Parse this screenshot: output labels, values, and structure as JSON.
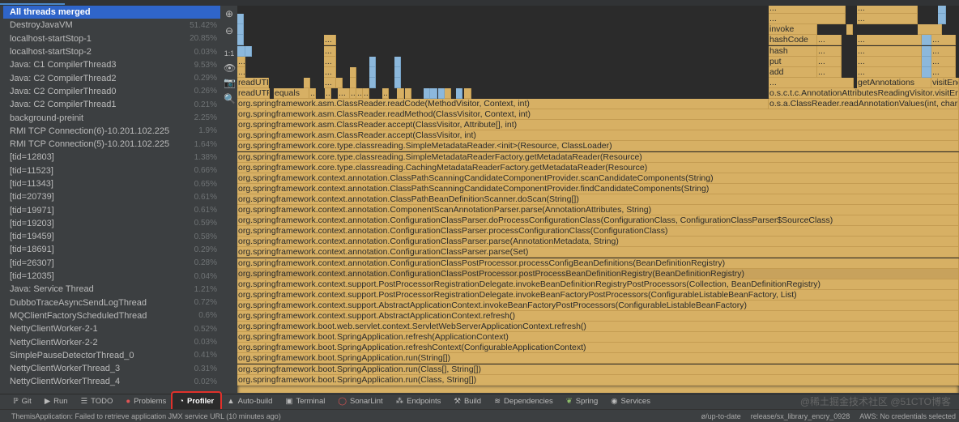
{
  "threads": [
    {
      "name": "All threads merged",
      "pct": ""
    },
    {
      "name": "DestroyJavaVM",
      "pct": "51.42%"
    },
    {
      "name": "localhost-startStop-1",
      "pct": "20.85%"
    },
    {
      "name": "localhost-startStop-2",
      "pct": "0.03%"
    },
    {
      "name": "Java: C1 CompilerThread3",
      "pct": "9.53%"
    },
    {
      "name": "Java: C2 CompilerThread2",
      "pct": "0.29%"
    },
    {
      "name": "Java: C2 CompilerThread0",
      "pct": "0.26%"
    },
    {
      "name": "Java: C2 CompilerThread1",
      "pct": "0.21%"
    },
    {
      "name": "background-preinit",
      "pct": "2.25%"
    },
    {
      "name": "RMI TCP Connection(6)-10.201.102.225",
      "pct": "1.9%"
    },
    {
      "name": "RMI TCP Connection(5)-10.201.102.225",
      "pct": "1.64%"
    },
    {
      "name": "[tid=12803]",
      "pct": "1.38%"
    },
    {
      "name": "[tid=11523]",
      "pct": "0.66%"
    },
    {
      "name": "[tid=11343]",
      "pct": "0.65%"
    },
    {
      "name": "[tid=20739]",
      "pct": "0.61%"
    },
    {
      "name": "[tid=19971]",
      "pct": "0.61%"
    },
    {
      "name": "[tid=19203]",
      "pct": "0.59%"
    },
    {
      "name": "[tid=19459]",
      "pct": "0.58%"
    },
    {
      "name": "[tid=18691]",
      "pct": "0.29%"
    },
    {
      "name": "[tid=26307]",
      "pct": "0.28%"
    },
    {
      "name": "[tid=12035]",
      "pct": "0.04%"
    },
    {
      "name": "Java: Service Thread",
      "pct": "1.21%"
    },
    {
      "name": "DubboTraceAsyncSendLogThread",
      "pct": "0.72%"
    },
    {
      "name": "MQClientFactoryScheduledThread",
      "pct": "0.6%"
    },
    {
      "name": "NettyClientWorker-2-1",
      "pct": "0.52%"
    },
    {
      "name": "NettyClientWorker-2-2",
      "pct": "0.03%"
    },
    {
      "name": "SimplePauseDetectorThread_0",
      "pct": "0.41%"
    },
    {
      "name": "NettyClientWorkerThread_3",
      "pct": "0.31%"
    },
    {
      "name": "NettyClientWorkerThread_4",
      "pct": "0.02%"
    }
  ],
  "selected_thread": "All threads merged",
  "tools": [
    {
      "icon": "zoom-in-icon",
      "glyph": "⊕"
    },
    {
      "icon": "zoom-out-icon",
      "glyph": "⊖"
    },
    {
      "icon": "actual-size-icon",
      "glyph": "1:1"
    },
    {
      "icon": "eye-icon",
      "glyph": "👁"
    },
    {
      "icon": "screenshot-icon",
      "glyph": "📷"
    },
    {
      "icon": "search-icon",
      "glyph": "🔍"
    }
  ],
  "flame": {
    "stack": [
      "org.springframework.asm.ClassReader.readCode(MethodVisitor, Context, int)",
      "org.springframework.asm.ClassReader.readMethod(ClassVisitor, Context, int)",
      "org.springframework.asm.ClassReader.accept(ClassVisitor, Attribute[], int)",
      "org.springframework.asm.ClassReader.accept(ClassVisitor, int)",
      "org.springframework.core.type.classreading.SimpleMetadataReader.<init>(Resource, ClassLoader)",
      "org.springframework.core.type.classreading.SimpleMetadataReaderFactory.getMetadataReader(Resource)",
      "org.springframework.core.type.classreading.CachingMetadataReaderFactory.getMetadataReader(Resource)",
      "org.springframework.context.annotation.ClassPathScanningCandidateComponentProvider.scanCandidateComponents(String)",
      "org.springframework.context.annotation.ClassPathScanningCandidateComponentProvider.findCandidateComponents(String)",
      "org.springframework.context.annotation.ClassPathBeanDefinitionScanner.doScan(String[])",
      "org.springframework.context.annotation.ComponentScanAnnotationParser.parse(AnnotationAttributes, String)",
      "org.springframework.context.annotation.ConfigurationClassParser.doProcessConfigurationClass(ConfigurationClass, ConfigurationClassParser$SourceClass)",
      "org.springframework.context.annotation.ConfigurationClassParser.processConfigurationClass(ConfigurationClass)",
      "org.springframework.context.annotation.ConfigurationClassParser.parse(AnnotationMetadata, String)",
      "org.springframework.context.annotation.ConfigurationClassParser.parse(Set)",
      "org.springframework.context.annotation.ConfigurationClassPostProcessor.processConfigBeanDefinitions(BeanDefinitionRegistry)",
      "org.springframework.context.annotation.ConfigurationClassPostProcessor.postProcessBeanDefinitionRegistry(BeanDefinitionRegistry)",
      "org.springframework.context.support.PostProcessorRegistrationDelegate.invokeBeanDefinitionRegistryPostProcessors(Collection, BeanDefinitionRegistry)",
      "org.springframework.context.support.PostProcessorRegistrationDelegate.invokeBeanFactoryPostProcessors(ConfigurableListableBeanFactory, List)",
      "org.springframework.context.support.AbstractApplicationContext.invokeBeanFactoryPostProcessors(ConfigurableListableBeanFactory)",
      "org.springframework.context.support.AbstractApplicationContext.refresh()",
      "org.springframework.boot.web.servlet.context.ServletWebServerApplicationContext.refresh()",
      "org.springframework.boot.SpringApplication.refresh(ApplicationContext)",
      "org.springframework.boot.SpringApplication.refreshContext(ConfigurableApplicationContext)",
      "org.springframework.boot.SpringApplication.run(String[])",
      "org.springframework.boot.SpringApplication.run(Class[], String[])",
      "org.springframework.boot.SpringApplication.run(Class, String[])",
      ""
    ],
    "highlighted_frame": "org.springframework.context.annotation.ConfigurationClassPostProcessor.postProcessBeanDefinitionRegistry(BeanDefinitionRegistry)",
    "left_small": {
      "readUTF8": "readUTF8",
      "readUTF": "readUTF",
      "equals": "equals",
      "ellipsis": "..."
    },
    "right": {
      "readAnnotationValues": "o.s.a.ClassReader.readAnnotationValues(int, char[], boolean, AnnotationVisitor)",
      "visitor": "o.s.c.t.c.AnnotationAttributesReadingVisitor.visitEnd()",
      "getAnnotations": "getAnnotations",
      "visitEn": "visitEnd",
      "add": "add",
      "put": "put",
      "hash": "hash",
      "hashCode": "hashCode",
      "invoke": "invoke"
    },
    "colors": {
      "frame": "#d7b064",
      "highlight_frame": "#c8a25c",
      "jit_frame": "#8cb8dc",
      "background": "#2b2b2b"
    }
  },
  "bottom_tools": [
    {
      "label": "Git",
      "icon": "git-branch-icon",
      "glyph": "ℙ"
    },
    {
      "label": "Run",
      "icon": "run-icon",
      "glyph": "▶"
    },
    {
      "label": "TODO",
      "icon": "list-icon",
      "glyph": "☰"
    },
    {
      "label": "Problems",
      "icon": "error-icon",
      "glyph": "●"
    },
    {
      "label": "Profiler",
      "icon": "profiler-icon",
      "glyph": "◔"
    },
    {
      "label": "Auto-build",
      "icon": "warning-icon",
      "glyph": "▲"
    },
    {
      "label": "Terminal",
      "icon": "terminal-icon",
      "glyph": "▣"
    },
    {
      "label": "SonarLint",
      "icon": "sonarlint-icon",
      "glyph": "◯"
    },
    {
      "label": "Endpoints",
      "icon": "endpoints-icon",
      "glyph": "⁂"
    },
    {
      "label": "Build",
      "icon": "hammer-icon",
      "glyph": "⚒"
    },
    {
      "label": "Dependencies",
      "icon": "dependencies-icon",
      "glyph": "≋"
    },
    {
      "label": "Spring",
      "icon": "spring-leaf-icon",
      "glyph": "❦"
    },
    {
      "label": "Services",
      "icon": "services-icon",
      "glyph": "◉"
    }
  ],
  "active_tool": "Profiler",
  "status": {
    "message": "ThemisApplication: Failed to retrieve application JMX service URL (10 minutes ago)",
    "vcs_status": "ø/up-to-date",
    "branch": "release/sx_library_encry_0928",
    "aws": "AWS: No credentials selected",
    "watermark": "@稀土掘金技术社区 @51CTO博客"
  }
}
